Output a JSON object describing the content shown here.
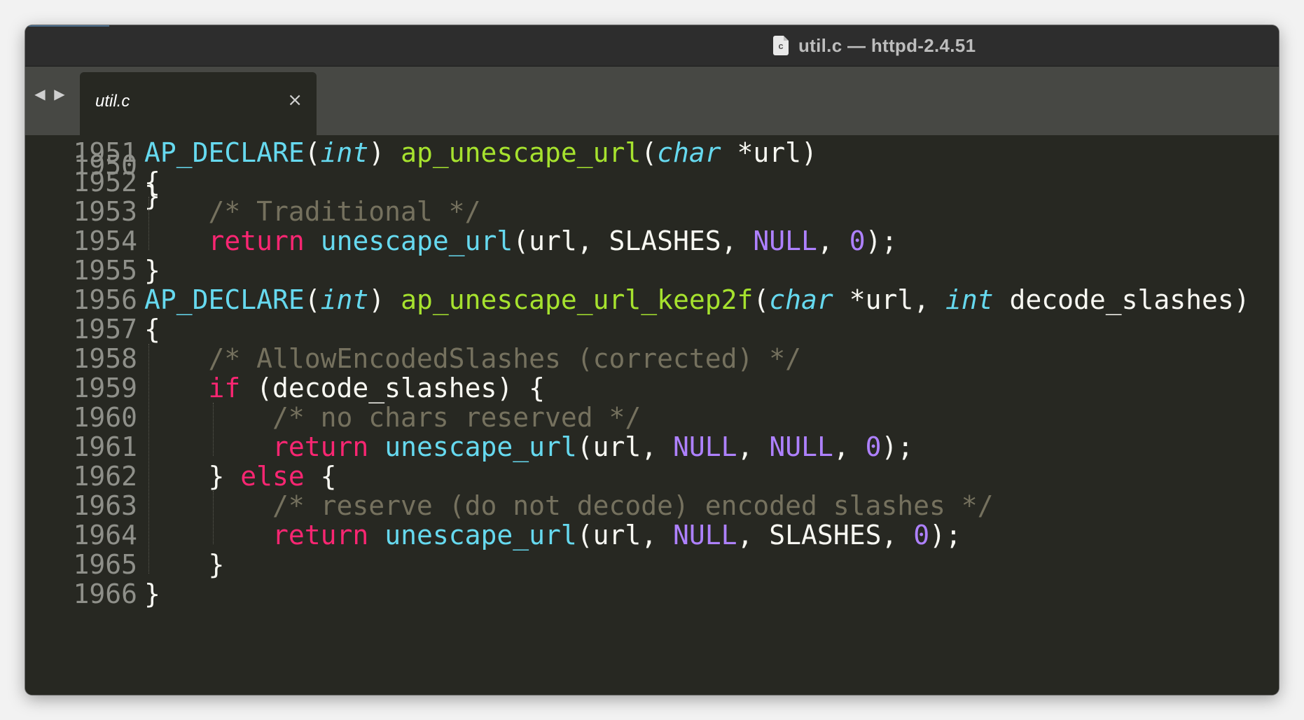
{
  "window": {
    "title": "util.c — httpd-2.4.51",
    "file_icon_letter": "c"
  },
  "tabbar": {
    "back_arrow": "◀",
    "forward_arrow": "▶",
    "tabs": [
      {
        "label": "util.c",
        "close": "×",
        "active": true
      }
    ]
  },
  "colors": {
    "background": "#272822",
    "keyword": "#f92672",
    "function_def": "#a6e22e",
    "function_call": "#66d9ef",
    "type": "#66d9ef",
    "constant": "#ae81ff",
    "comment": "#75715e",
    "text": "#f8f8f2",
    "line_number": "#8f908a"
  },
  "editor": {
    "partial_top": {
      "number": "1950",
      "code": "}"
    },
    "lines": [
      {
        "number": "1951",
        "tokens": [
          {
            "t": "AP_DECLARE",
            "c": "call"
          },
          {
            "t": "(",
            "c": "plain"
          },
          {
            "t": "int",
            "c": "type"
          },
          {
            "t": ") ",
            "c": "plain"
          },
          {
            "t": "ap_unescape_url",
            "c": "fn"
          },
          {
            "t": "(",
            "c": "plain"
          },
          {
            "t": "char",
            "c": "type"
          },
          {
            "t": " *url)",
            "c": "plain"
          }
        ]
      },
      {
        "number": "1952",
        "tokens": [
          {
            "t": "{",
            "c": "plain"
          }
        ]
      },
      {
        "number": "1953",
        "tokens": [
          {
            "t": "    ",
            "c": "plain"
          },
          {
            "t": "/* Traditional */",
            "c": "cmt"
          }
        ]
      },
      {
        "number": "1954",
        "tokens": [
          {
            "t": "    ",
            "c": "plain"
          },
          {
            "t": "return",
            "c": "kw"
          },
          {
            "t": " ",
            "c": "plain"
          },
          {
            "t": "unescape_url",
            "c": "call"
          },
          {
            "t": "(url, SLASHES, ",
            "c": "plain"
          },
          {
            "t": "NULL",
            "c": "const"
          },
          {
            "t": ", ",
            "c": "plain"
          },
          {
            "t": "0",
            "c": "const"
          },
          {
            "t": ");",
            "c": "plain"
          }
        ]
      },
      {
        "number": "1955",
        "tokens": [
          {
            "t": "}",
            "c": "plain"
          }
        ]
      },
      {
        "number": "1956",
        "tokens": [
          {
            "t": "AP_DECLARE",
            "c": "call"
          },
          {
            "t": "(",
            "c": "plain"
          },
          {
            "t": "int",
            "c": "type"
          },
          {
            "t": ") ",
            "c": "plain"
          },
          {
            "t": "ap_unescape_url_keep2f",
            "c": "fn"
          },
          {
            "t": "(",
            "c": "plain"
          },
          {
            "t": "char",
            "c": "type"
          },
          {
            "t": " *url, ",
            "c": "plain"
          },
          {
            "t": "int",
            "c": "type"
          },
          {
            "t": " decode_slashes)",
            "c": "plain"
          }
        ]
      },
      {
        "number": "1957",
        "tokens": [
          {
            "t": "{",
            "c": "plain"
          }
        ]
      },
      {
        "number": "1958",
        "tokens": [
          {
            "t": "    ",
            "c": "plain"
          },
          {
            "t": "/* AllowEncodedSlashes (corrected) */",
            "c": "cmt"
          }
        ]
      },
      {
        "number": "1959",
        "tokens": [
          {
            "t": "    ",
            "c": "plain"
          },
          {
            "t": "if",
            "c": "kw"
          },
          {
            "t": " (decode_slashes) {",
            "c": "plain"
          }
        ]
      },
      {
        "number": "1960",
        "tokens": [
          {
            "t": "        ",
            "c": "plain"
          },
          {
            "t": "/* no chars reserved */",
            "c": "cmt"
          }
        ]
      },
      {
        "number": "1961",
        "tokens": [
          {
            "t": "        ",
            "c": "plain"
          },
          {
            "t": "return",
            "c": "kw"
          },
          {
            "t": " ",
            "c": "plain"
          },
          {
            "t": "unescape_url",
            "c": "call"
          },
          {
            "t": "(url, ",
            "c": "plain"
          },
          {
            "t": "NULL",
            "c": "const"
          },
          {
            "t": ", ",
            "c": "plain"
          },
          {
            "t": "NULL",
            "c": "const"
          },
          {
            "t": ", ",
            "c": "plain"
          },
          {
            "t": "0",
            "c": "const"
          },
          {
            "t": ");",
            "c": "plain"
          }
        ]
      },
      {
        "number": "1962",
        "tokens": [
          {
            "t": "    } ",
            "c": "plain"
          },
          {
            "t": "else",
            "c": "kw"
          },
          {
            "t": " {",
            "c": "plain"
          }
        ]
      },
      {
        "number": "1963",
        "tokens": [
          {
            "t": "        ",
            "c": "plain"
          },
          {
            "t": "/* reserve (do not decode) encoded slashes */",
            "c": "cmt"
          }
        ]
      },
      {
        "number": "1964",
        "tokens": [
          {
            "t": "        ",
            "c": "plain"
          },
          {
            "t": "return",
            "c": "kw"
          },
          {
            "t": " ",
            "c": "plain"
          },
          {
            "t": "unescape_url",
            "c": "call"
          },
          {
            "t": "(url, ",
            "c": "plain"
          },
          {
            "t": "NULL",
            "c": "const"
          },
          {
            "t": ", SLASHES, ",
            "c": "plain"
          },
          {
            "t": "0",
            "c": "const"
          },
          {
            "t": ");",
            "c": "plain"
          }
        ]
      },
      {
        "number": "1965",
        "tokens": [
          {
            "t": "    }",
            "c": "plain"
          }
        ]
      },
      {
        "number": "1966",
        "tokens": [
          {
            "t": "}",
            "c": "plain"
          }
        ]
      }
    ]
  }
}
